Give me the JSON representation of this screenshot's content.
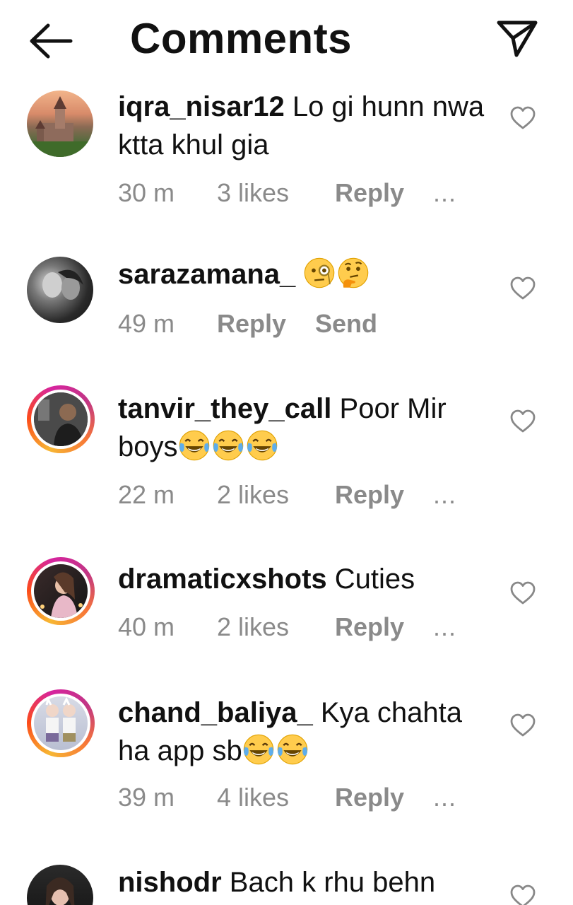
{
  "header": {
    "title": "Comments",
    "back_icon": "arrow-left-icon",
    "send_icon": "paper-plane-icon"
  },
  "comments": [
    {
      "username": "iqra_nisar12",
      "text": "Lo gi  hunn nwa ktta khul gia",
      "time": "30 m",
      "likes": "3 likes",
      "reply": "Reply",
      "more": "...",
      "story_ring": false,
      "emojis": []
    },
    {
      "username": "sarazamana_",
      "text": "",
      "time": "49 m",
      "reply": "Reply",
      "send": "Send",
      "story_ring": false,
      "emojis": [
        "face-with-monocle",
        "thinking-face"
      ]
    },
    {
      "username": "tanvir_they_call",
      "text": "Poor Mir boys",
      "time": "22 m",
      "likes": "2 likes",
      "reply": "Reply",
      "more": "...",
      "story_ring": true,
      "emojis": [
        "face-with-tears-of-joy",
        "face-with-tears-of-joy",
        "face-with-tears-of-joy"
      ]
    },
    {
      "username": "dramaticxshots",
      "text": "Cuties",
      "time": "40 m",
      "likes": "2 likes",
      "reply": "Reply",
      "more": "...",
      "story_ring": true,
      "emojis": []
    },
    {
      "username": "chand_baliya_",
      "text": "Kya chahta ha app sb",
      "time": "39 m",
      "likes": "4 likes",
      "reply": "Reply",
      "more": "...",
      "story_ring": true,
      "emojis": [
        "face-with-tears-of-joy",
        "face-with-tears-of-joy"
      ]
    },
    {
      "username": "nishodr",
      "text": "Bach k rhu behn",
      "story_ring": false,
      "emojis": []
    }
  ],
  "colors": {
    "meta_gray": "#8a8a8a",
    "text": "#111111",
    "ring_start": "#f7b733",
    "ring_end": "#c13584"
  }
}
